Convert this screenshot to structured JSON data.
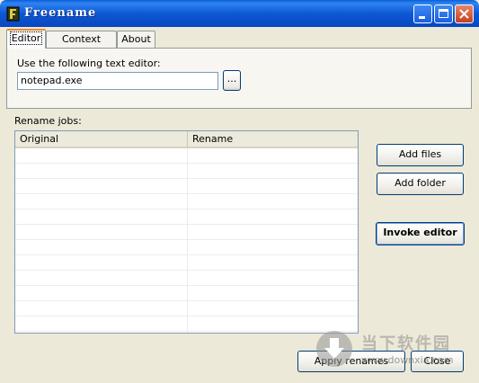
{
  "window": {
    "title": "Freename"
  },
  "tabs": [
    {
      "label": "Editor",
      "active": true
    },
    {
      "label": "Context menu",
      "active": false
    },
    {
      "label": "About",
      "active": false
    }
  ],
  "editor": {
    "label": "Use the following text editor:",
    "value": "notepad.exe",
    "browse_label": "..."
  },
  "rename_jobs": {
    "label": "Rename jobs:",
    "columns": [
      "Original",
      "Rename"
    ]
  },
  "buttons": {
    "add_files": "Add files",
    "add_folder": "Add folder",
    "invoke_editor": "Invoke editor",
    "apply_renames": "Apply renames",
    "close": "Close"
  },
  "watermark": {
    "text": "当下软件园",
    "url": "www.downxia.com"
  },
  "colors": {
    "titlebar": "#0a58d4",
    "face": "#ece9d8",
    "border": "#7f9db9"
  }
}
